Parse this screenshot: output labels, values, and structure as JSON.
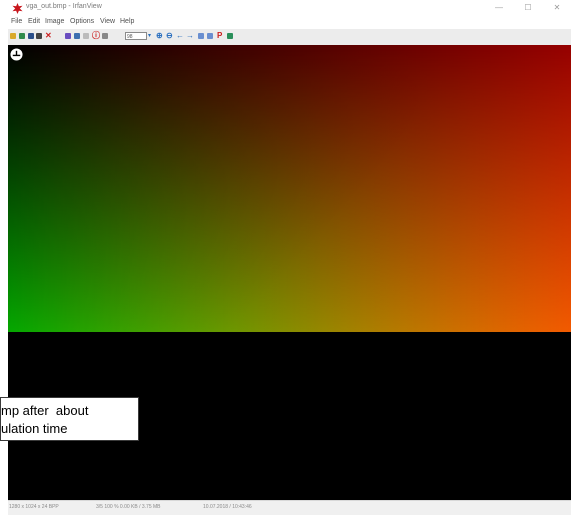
{
  "window": {
    "title": "vga_out.bmp - IrfanView"
  },
  "titlebar": {
    "minimize": "—",
    "maximize": "☐",
    "close": "✕"
  },
  "menu": [
    "File",
    "Edit",
    "Image",
    "Options",
    "View",
    "Help"
  ],
  "toolbar": {
    "zoom_value": "98"
  },
  "status": {
    "dimensions": "1280 x 1024 x 24 BPP",
    "zoom": "3/5 100 %   0.00 KB / 3.75 MB",
    "datetime": "10.07.2018 / 10:43:46"
  },
  "caption": {
    "line1": "mp after  about",
    "line2": "ulation time"
  },
  "colors": {
    "accent_red": "#cc1e1e",
    "toolbar_blue": "#2a6fbf"
  },
  "icons": [
    "app-icon",
    "open-icon",
    "thumbnails-icon",
    "save-icon",
    "print-icon",
    "delete-icon",
    "info-icon",
    "zoom-in-icon",
    "zoom-out-icon",
    "previous-icon",
    "next-icon",
    "paint-icon",
    "scroll-up-icon"
  ]
}
